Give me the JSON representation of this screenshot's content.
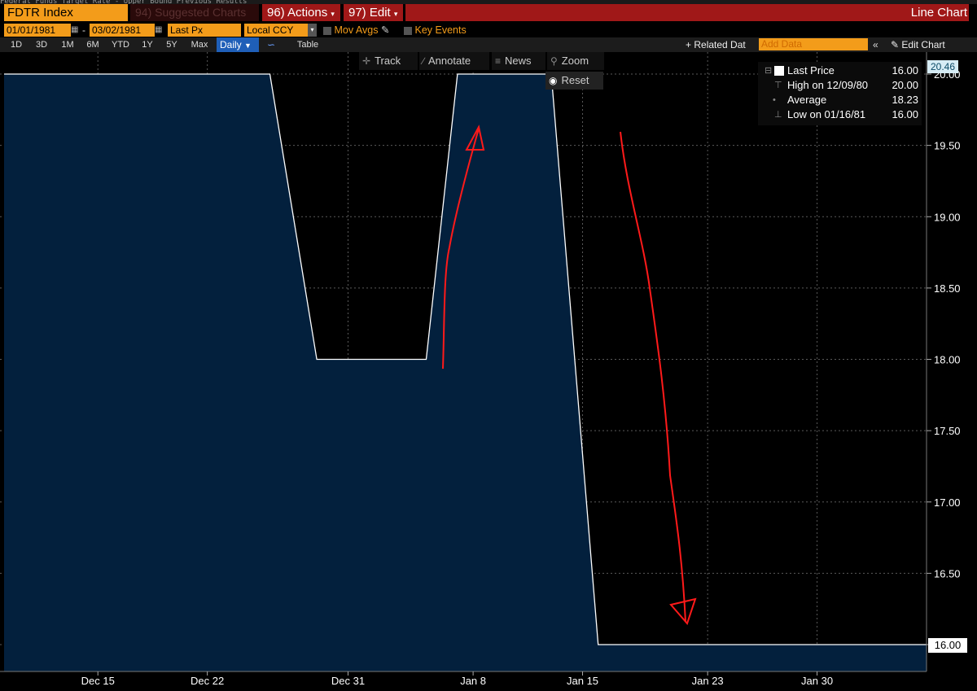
{
  "header": {
    "ticker": "FDTR Index",
    "suggested_charts": "Suggested Charts",
    "suggested_prefix": "94)",
    "actions_prefix": "96)",
    "actions_label": "Actions",
    "edit_prefix": "97)",
    "edit_label": "Edit",
    "chart_type": "Line Chart",
    "cut_text": "Federal Funds Target Rate - Upper Bound     Previous Results"
  },
  "toolbar": {
    "start_date": "01/01/1981",
    "end_date": "03/02/1981",
    "date_separator": "-",
    "field": "Last Px",
    "currency": "Local CCY",
    "mov_avgs": "Mov Avgs",
    "key_events": "Key Events"
  },
  "periods": [
    "1D",
    "3D",
    "1M",
    "6M",
    "YTD",
    "1Y",
    "5Y",
    "Max"
  ],
  "frequency": "Daily",
  "table_label": "Table",
  "related_data": "Related Dat",
  "add_data_placeholder": "Add Data",
  "edit_chart": "Edit Chart",
  "chart_tools": {
    "track": "Track",
    "annotate": "Annotate",
    "news": "News",
    "zoom": "Zoom",
    "reset": "Reset"
  },
  "legend": {
    "last_price_label": "Last Price",
    "last_price_value": "16.00",
    "high_label": "High on 12/09/80",
    "high_value": "20.00",
    "average_label": "Average",
    "average_value": "18.23",
    "low_label": "Low on 01/16/81",
    "low_value": "16.00"
  },
  "price_tags": {
    "top": "20.46",
    "last": "16.00"
  },
  "colors": {
    "accent_orange": "#f39c1a",
    "header_red": "#a01818",
    "area_fill": "#03203d",
    "annotation_red": "#ff1a1a"
  },
  "chart_data": {
    "type": "area",
    "series": [
      {
        "name": "Last Price",
        "points": [
          [
            "1980-12-09",
            20.0
          ],
          [
            "1980-12-26",
            20.0
          ],
          [
            "1980-12-29",
            18.0
          ],
          [
            "1981-01-05",
            18.0
          ],
          [
            "1981-01-07",
            20.0
          ],
          [
            "1981-01-13",
            20.0
          ],
          [
            "1981-01-16",
            16.0
          ],
          [
            "1981-02-06",
            16.0
          ]
        ]
      }
    ],
    "x_ticks": [
      "Dec 15",
      "Dec 22",
      "Dec 31",
      "Jan 8",
      "Jan 15",
      "Jan 23",
      "Jan 30"
    ],
    "y_ticks": [
      "16.00",
      "16.50",
      "17.00",
      "17.50",
      "18.00",
      "18.50",
      "19.00",
      "19.50",
      "20.00",
      "20.50"
    ],
    "ylim": [
      15.95,
      20.5
    ],
    "grid": true,
    "legend_position": "top-right",
    "annotations": [
      "red hand-drawn arrow pointing up",
      "red hand-drawn arrow pointing down"
    ]
  }
}
